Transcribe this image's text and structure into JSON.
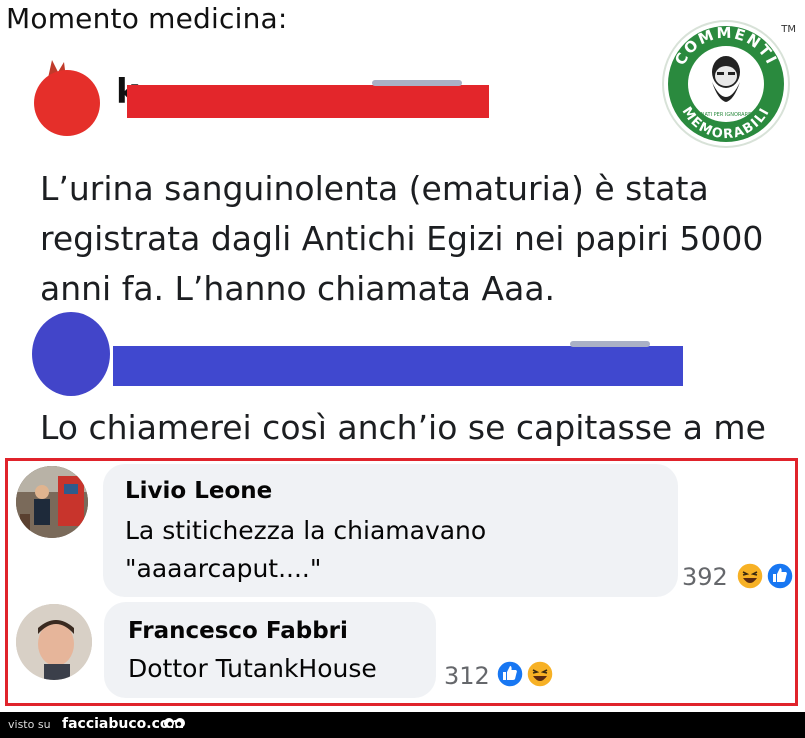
{
  "header": {
    "title": "Momento medicina:"
  },
  "logo": {
    "top_text": "COMMENTI",
    "bottom_text": "MEMORABILI",
    "small_text": "NATI PER IGNORARE",
    "trademark": "TM"
  },
  "post": {
    "username_partial": "k",
    "text": "L’urina sanguinolenta (ematuria) è stata registrata dagli Antichi Egizi nei papiri 5000 anni fa. L’hanno chiamata Aaa."
  },
  "reply": {
    "text": "Lo chiamerei così anch’io se capitasse a me"
  },
  "comments": [
    {
      "name": "Livio Leone",
      "lines": [
        "La stitichezza la chiamavano",
        "\"aaaarcaput....\""
      ],
      "count": "392"
    },
    {
      "name": "Francesco Fabbri",
      "lines": [
        "Dottor TutankHouse"
      ],
      "count": "312"
    }
  ],
  "footer": {
    "visto": "visto su",
    "site": "facciabuco.com"
  },
  "colors": {
    "red_bar": "#e3262b",
    "blue_bar": "#4048cf",
    "frame": "#e0232b",
    "logo_green": "#2a8a3e"
  }
}
